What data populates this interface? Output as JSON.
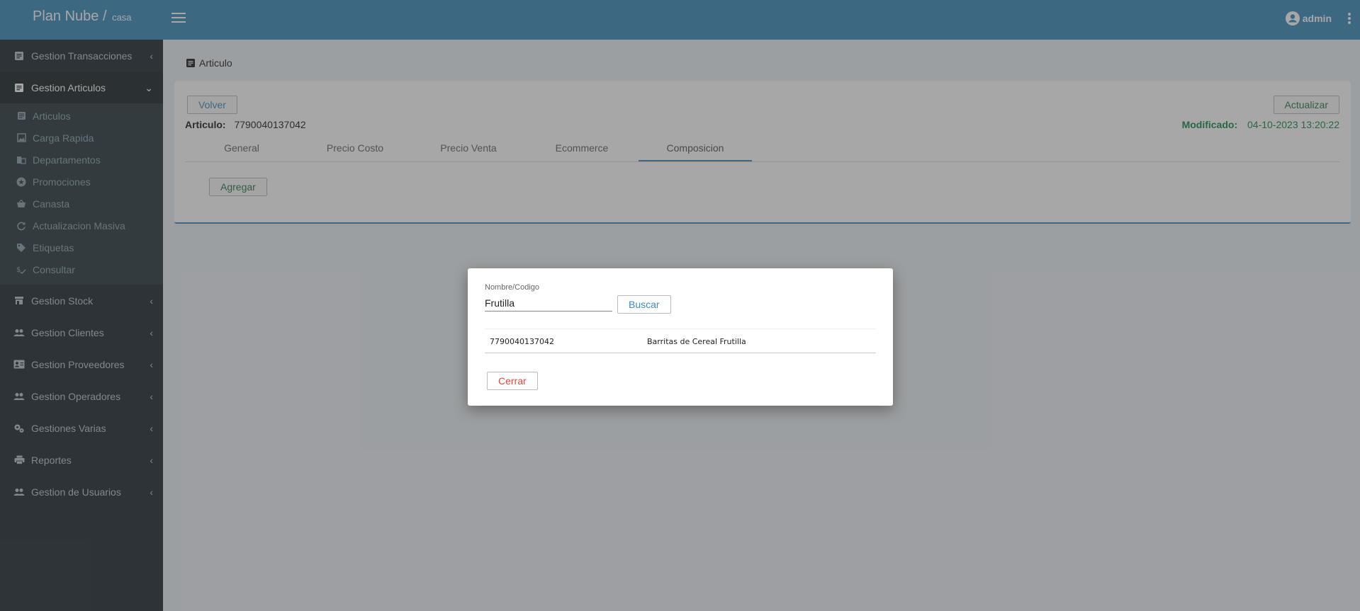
{
  "header": {
    "brand": "Plan Nube /",
    "brand_sub": "casa",
    "user": "admin"
  },
  "sidebar": {
    "items": [
      {
        "label": "Gestion Transacciones",
        "icon": "document-icon"
      },
      {
        "label": "Gestion Articulos",
        "icon": "document-icon",
        "expanded": true
      },
      {
        "label": "Gestion Stock",
        "icon": "store-icon"
      },
      {
        "label": "Gestion Clientes",
        "icon": "people-icon"
      },
      {
        "label": "Gestion Proveedores",
        "icon": "contact-card-icon"
      },
      {
        "label": "Gestion Operadores",
        "icon": "people-icon"
      },
      {
        "label": "Gestiones Varias",
        "icon": "gears-icon"
      },
      {
        "label": "Reportes",
        "icon": "printer-icon"
      },
      {
        "label": "Gestion de Usuarios",
        "icon": "people-icon"
      }
    ],
    "subitems": [
      {
        "label": "Articulos",
        "icon": "document-icon"
      },
      {
        "label": "Carga Rapida",
        "icon": "image-icon"
      },
      {
        "label": "Departamentos",
        "icon": "building-icon"
      },
      {
        "label": "Promociones",
        "icon": "star-circle-icon"
      },
      {
        "label": "Canasta",
        "icon": "basket-icon"
      },
      {
        "label": "Actualizacion Masiva",
        "icon": "refresh-icon"
      },
      {
        "label": "Etiquetas",
        "icon": "tag-icon"
      },
      {
        "label": "Consultar",
        "icon": "price-check-icon"
      }
    ]
  },
  "page": {
    "title": "Articulo",
    "volver_label": "Volver",
    "actualizar_label": "Actualizar",
    "articulo_label": "Articulo:",
    "articulo_value": "7790040137042",
    "modificado_label": "Modificado:",
    "modificado_value": "04-10-2023 13:20:22",
    "tabs": [
      "General",
      "Precio Costo",
      "Precio Venta",
      "Ecommerce",
      "Composicion"
    ],
    "active_tab": "Composicion",
    "agregar_label": "Agregar"
  },
  "modal": {
    "field_label": "Nombre/Codigo",
    "field_value": "Frutilla",
    "buscar_label": "Buscar",
    "results": [
      {
        "codigo": "7790040137042",
        "nombre": "Barritas de Cereal Frutilla"
      }
    ],
    "cerrar_label": "Cerrar"
  },
  "colors": {
    "header": "#3c8dbc",
    "sidebar": "#222d32",
    "danger": "#dd4b39",
    "success": "#1a8a4a"
  }
}
